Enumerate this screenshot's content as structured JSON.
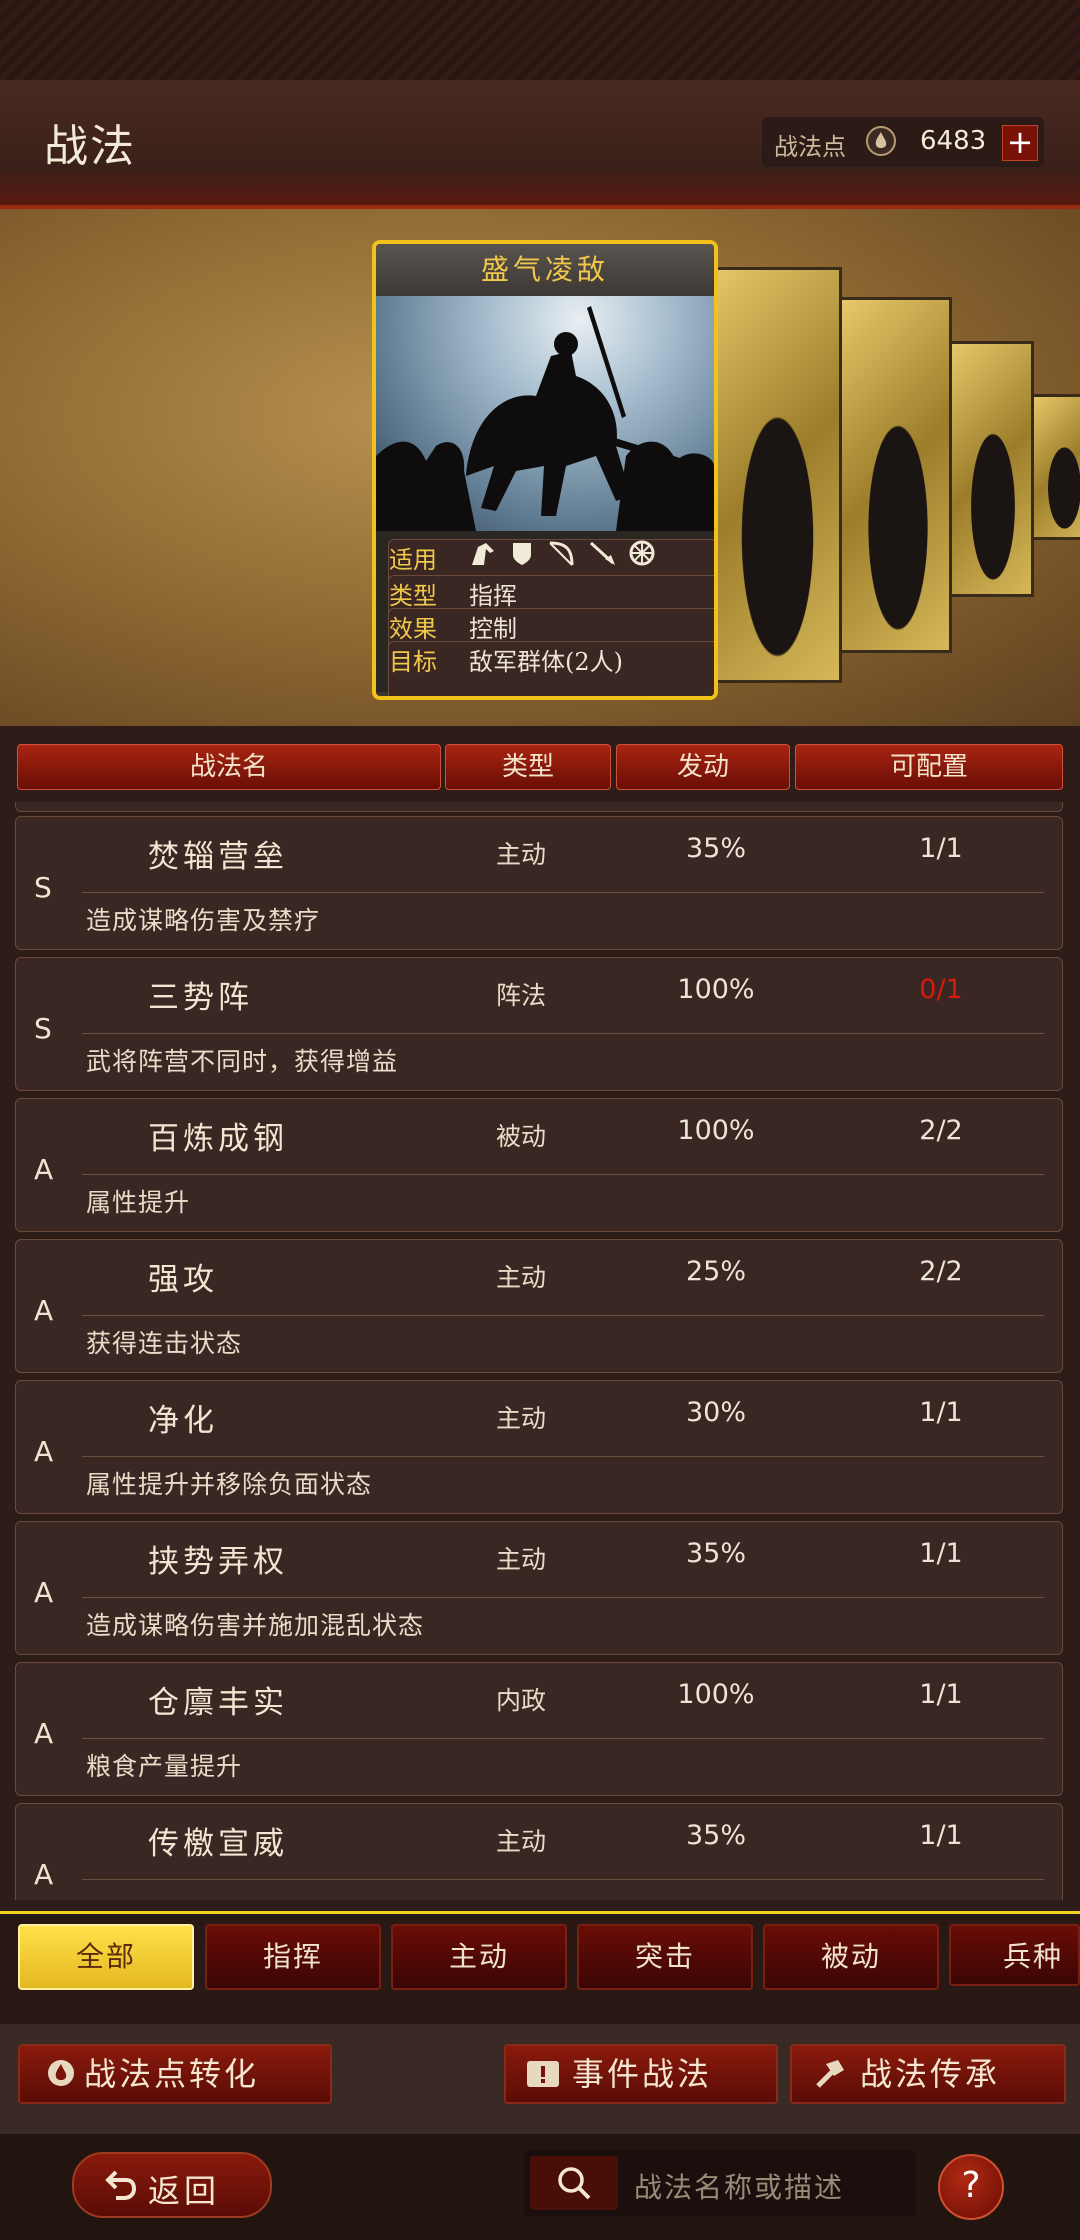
{
  "header": {
    "title": "战法",
    "points_label": "战法点",
    "points_value": "6483",
    "plus": "+"
  },
  "featured": {
    "name": "盛气凌敌",
    "use_label": "适用",
    "use_icons": [
      "cavalry-icon",
      "shield-icon",
      "bow-icon",
      "spear-icon",
      "wheel-icon"
    ],
    "type_label": "类型",
    "type_value": "指挥",
    "effect_label": "效果",
    "effect_value": "控制",
    "target_label": "目标",
    "target_value": "敌军群体(2人)"
  },
  "table": {
    "headers": [
      "战法名",
      "类型",
      "发动",
      "可配置"
    ],
    "rows": [
      {
        "grade": "S",
        "name": "焚辎营垒",
        "type": "主动",
        "rate": "35%",
        "config": "1/1",
        "desc": "造成谋略伤害及禁疗"
      },
      {
        "grade": "S",
        "name": "三势阵",
        "type": "阵法",
        "rate": "100%",
        "config": "0/1",
        "desc": "武将阵营不同时，获得增益"
      },
      {
        "grade": "A",
        "name": "百炼成钢",
        "type": "被动",
        "rate": "100%",
        "config": "2/2",
        "desc": "属性提升"
      },
      {
        "grade": "A",
        "name": "强攻",
        "type": "主动",
        "rate": "25%",
        "config": "2/2",
        "desc": "获得连击状态"
      },
      {
        "grade": "A",
        "name": "净化",
        "type": "主动",
        "rate": "30%",
        "config": "1/1",
        "desc": "属性提升并移除负面状态"
      },
      {
        "grade": "A",
        "name": "挟势弄权",
        "type": "主动",
        "rate": "35%",
        "config": "1/1",
        "desc": "造成谋略伤害并施加混乱状态"
      },
      {
        "grade": "A",
        "name": "仓廪丰实",
        "type": "内政",
        "rate": "100%",
        "config": "1/1",
        "desc": "粮食产量提升"
      },
      {
        "grade": "A",
        "name": "传檄宣威",
        "type": "主动",
        "rate": "35%",
        "config": "1/1",
        "desc": ""
      }
    ]
  },
  "filters": [
    "全部",
    "指挥",
    "主动",
    "突击",
    "被动",
    "兵种"
  ],
  "actions": {
    "convert": "战法点转化",
    "event": "事件战法",
    "inherit": "战法传承"
  },
  "bottom": {
    "back": "返回",
    "search_placeholder": "战法名称或描述",
    "help": "?"
  },
  "colors": {
    "accent_gold": "#f2c21a",
    "header_red": "#a82412",
    "unavailable_red": "#d81a0a"
  }
}
